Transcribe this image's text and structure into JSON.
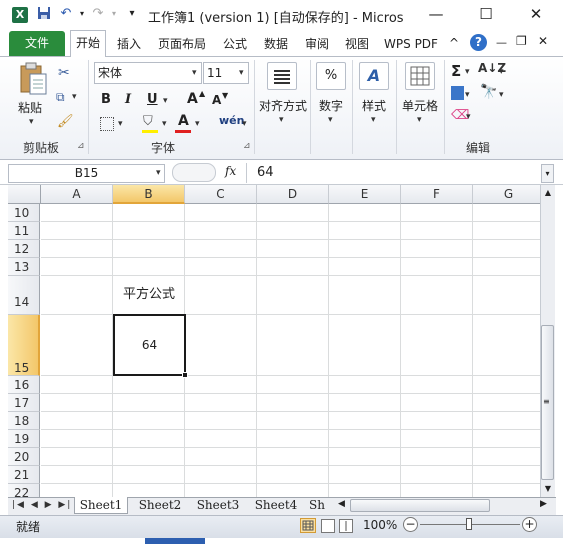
{
  "window": {
    "title": "工作簿1 (version 1) [自动保存的]  -  Micros",
    "logo_letter": "X"
  },
  "ribbon_tabs": [
    "文件",
    "开始",
    "插入",
    "页面布局",
    "公式",
    "数据",
    "审阅",
    "视图",
    "WPS PDF"
  ],
  "ribbon": {
    "clipboard": {
      "paste": "粘贴",
      "group": "剪贴板"
    },
    "font": {
      "name": "宋体",
      "size": "11",
      "bold": "B",
      "italic": "I",
      "underline": "U",
      "grow": "A",
      "shrink": "A",
      "font_color": "A",
      "phonetic": "wén",
      "group": "字体"
    },
    "alignment": {
      "label": "对齐方式"
    },
    "number": {
      "label": "数字",
      "icon_text": "%"
    },
    "styles": {
      "label": "样式"
    },
    "cells": {
      "label": "单元格"
    },
    "editing": {
      "group": "编辑",
      "sum": "Σ"
    }
  },
  "formula_bar": {
    "name_box": "B15",
    "fx": "fx",
    "value": "64"
  },
  "grid": {
    "columns": [
      "A",
      "B",
      "C",
      "D",
      "E",
      "F",
      "G"
    ],
    "selected_column": "B",
    "rows": [
      "10",
      "11",
      "12",
      "13",
      "14",
      "15",
      "16",
      "17",
      "18",
      "19",
      "20",
      "21",
      "22"
    ],
    "selected_row": "15",
    "cells": {
      "B14": "平方公式",
      "B15": "64"
    }
  },
  "sheet_tabs": [
    "Sheet1",
    "Sheet2",
    "Sheet3",
    "Sheet4",
    "Sh"
  ],
  "active_sheet": "Sheet1",
  "status": {
    "ready": "就绪",
    "zoom": "100%"
  },
  "colors": {
    "file_tab": "#2a8c3c",
    "selection_header": "#f3c76a",
    "excel_green": "#1e7145"
  }
}
